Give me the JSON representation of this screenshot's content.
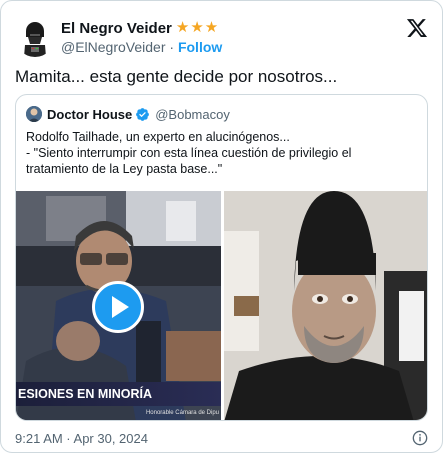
{
  "author": {
    "display_name": "El Negro Veider",
    "stars": [
      "★",
      "★",
      "★"
    ],
    "handle": "@ElNegroVeider",
    "separator": "·",
    "follow_label": "Follow"
  },
  "tweet": {
    "text": "Mamita... esta gente decide por nosotros..."
  },
  "quoted": {
    "display_name": "Doctor House",
    "handle": "@Bobmacoy",
    "text_line1": "Rodolfo Tailhade, un experto en alucinógenos...",
    "text_line2": "- \"Siento interrumpir con esta línea cuestión de privilegio el tratamiento de la Ley pasta base...\"",
    "media": {
      "banner_text": "ESIONES EN MINORÍA",
      "banner_sub": "Honorable Cámara de Dipu"
    }
  },
  "footer": {
    "timestamp": "9:21 AM · Apr 30, 2024"
  },
  "colors": {
    "accent": "#1d9bf0",
    "star": "#f5a623",
    "muted": "#536471"
  }
}
